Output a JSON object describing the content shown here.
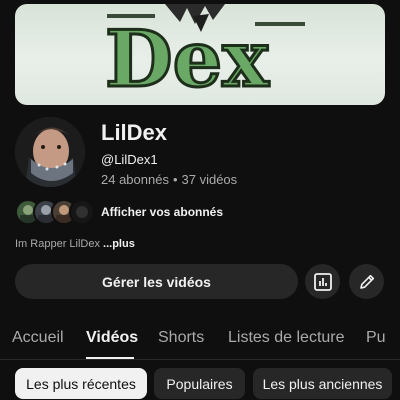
{
  "banner": {
    "text": "Dex"
  },
  "channel": {
    "name": "LilDex",
    "handle": "@LilDex1",
    "subscribers": "24 abonnés",
    "videos": "37 vidéos",
    "separator": "•"
  },
  "subscribers_link": "Afficher vos abonnés",
  "description": {
    "text": "Im Rapper LilDex ",
    "more": "...plus"
  },
  "actions": {
    "manage_label": "Gérer les vidéos",
    "analytics_icon": "analytics-icon",
    "edit_icon": "pencil-icon"
  },
  "tabs": [
    {
      "label": "Accueil"
    },
    {
      "label": "Vidéos",
      "active": true
    },
    {
      "label": "Shorts"
    },
    {
      "label": "Listes de lecture"
    },
    {
      "label": "Pu"
    }
  ],
  "chips": [
    {
      "label": "Les plus récentes",
      "selected": true
    },
    {
      "label": "Populaires"
    },
    {
      "label": "Les plus anciennes"
    }
  ],
  "colors": {
    "background": "#0f0f0f",
    "surface": "#272727",
    "text": "#f1f1f1",
    "secondary_text": "#aaaaaa",
    "banner_green": "#5f9a5a"
  }
}
